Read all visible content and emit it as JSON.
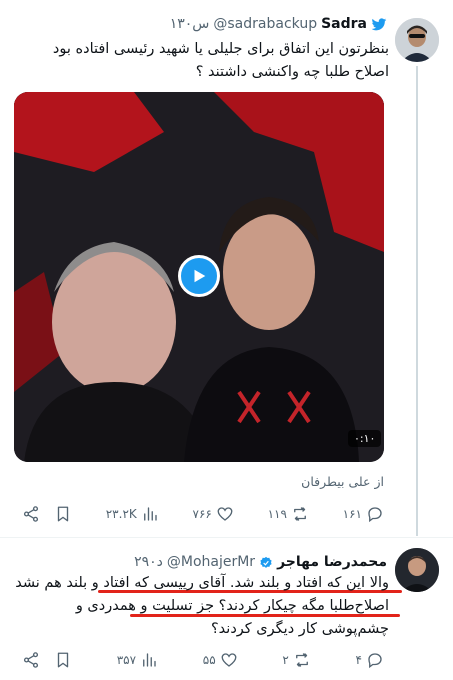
{
  "tweet1": {
    "name": "Sadra",
    "handle": "@sadrabackup",
    "time": "۱۳۰س",
    "text": "بنظرتون این اتفاق برای جلیلی یا شهید رئیسی افتاده بود اصلاح طلبا چه واکنشی داشتند ؟",
    "video_duration": "۰:۱۰",
    "from_label": "از علی بیطرفان",
    "actions": {
      "replies": "۱۶۱",
      "retweets": "۱۱۹",
      "likes": "۷۶۶",
      "views": "۲۳.۲K"
    }
  },
  "tweet2": {
    "name": "محمدرضا مهاجر",
    "handle": "@MohajerMr",
    "time": "۲۹۰د",
    "text": "والا این که افتاد و بلند شد. آقای رییسی که افتاد و بلند هم نشد اصلاح‌طلبا مگه چیکار کردند؟ جز تسلیت و همدردی و چشم‌پوشی کار دیگری کردند؟",
    "actions": {
      "replies": "۴",
      "retweets": "۲",
      "likes": "۵۵",
      "views": "۳۵۷"
    }
  },
  "colors": {
    "accent": "#1d9bf0",
    "underline": "#e2231a",
    "muted": "#536471"
  },
  "icons": [
    "twitter-bird-icon",
    "verified-badge-icon",
    "play-icon",
    "reply-icon",
    "retweet-icon",
    "like-icon",
    "views-icon",
    "bookmark-icon",
    "share-icon"
  ]
}
